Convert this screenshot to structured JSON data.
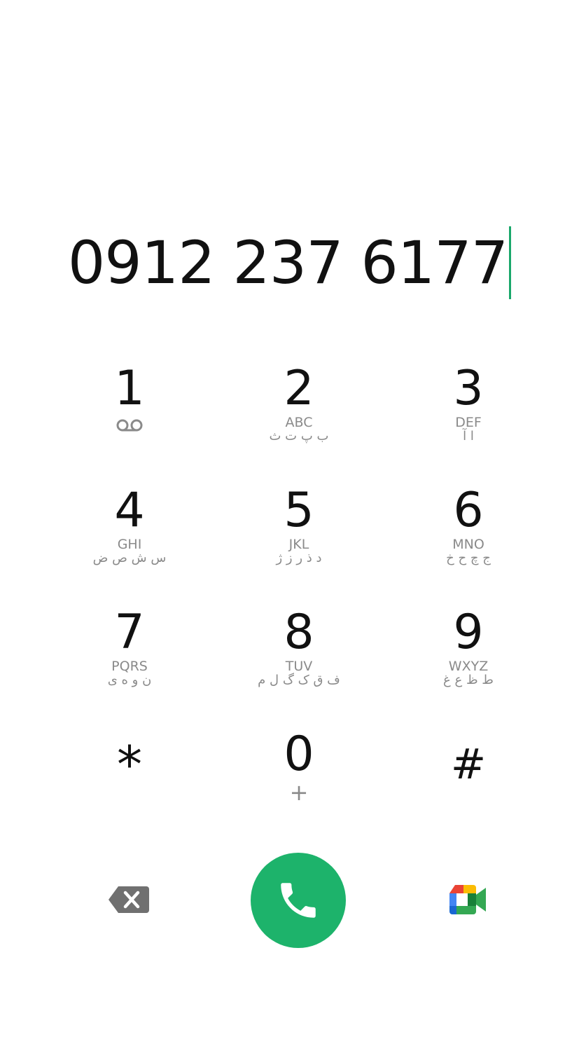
{
  "display": {
    "number": "0912 237 6177"
  },
  "keys": [
    {
      "digit": "1",
      "letters": "",
      "persian": ""
    },
    {
      "digit": "2",
      "letters": "ABC",
      "persian": "ب پ ت ث"
    },
    {
      "digit": "3",
      "letters": "DEF",
      "persian": "ا آ"
    },
    {
      "digit": "4",
      "letters": "GHI",
      "persian": "س ش ص ض"
    },
    {
      "digit": "5",
      "letters": "JKL",
      "persian": "د ذ ر ز ژ"
    },
    {
      "digit": "6",
      "letters": "MNO",
      "persian": "ج چ ح خ"
    },
    {
      "digit": "7",
      "letters": "PQRS",
      "persian": "ن و ه ی"
    },
    {
      "digit": "8",
      "letters": "TUV",
      "persian": "ف ق ک گ ل م"
    },
    {
      "digit": "9",
      "letters": "WXYZ",
      "persian": "ط ظ ع غ"
    },
    {
      "digit": "*",
      "letters": "",
      "persian": ""
    },
    {
      "digit": "0",
      "letters": "+",
      "persian": ""
    },
    {
      "digit": "#",
      "letters": "",
      "persian": ""
    }
  ],
  "icons": {
    "key1": "voicemail-icon",
    "backspace": "backspace-icon",
    "call": "phone-icon",
    "video": "google-meet-icon"
  },
  "colors": {
    "cursor": "#1aa86b",
    "call_button": "#1db36b",
    "secondary_text": "#8a8a8a"
  }
}
